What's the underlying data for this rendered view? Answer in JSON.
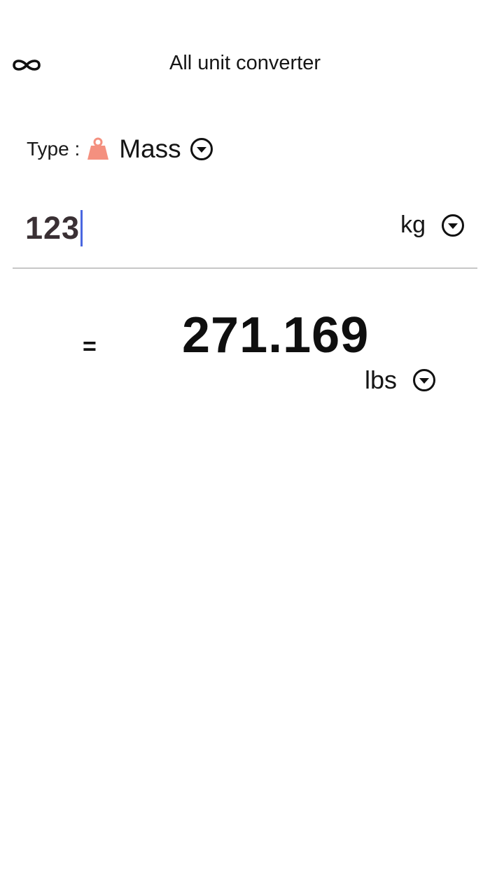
{
  "header": {
    "title": "All unit converter",
    "menu_icon": "infinity-icon"
  },
  "type_selector": {
    "label": "Type :",
    "value": "Mass",
    "icon": "weight-icon",
    "icon_color": "#f4907f"
  },
  "input": {
    "value": "123",
    "unit": "kg",
    "caret_color": "#4a67e0"
  },
  "result": {
    "equals": "=",
    "value": "271.169",
    "unit": "lbs"
  }
}
